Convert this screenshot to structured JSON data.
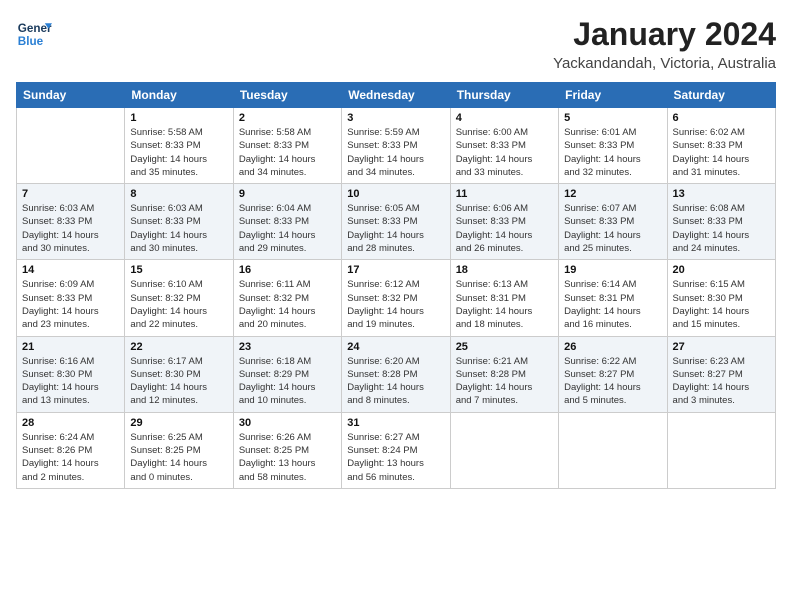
{
  "header": {
    "logo_line1": "General",
    "logo_line2": "Blue",
    "month": "January 2024",
    "location": "Yackandandah, Victoria, Australia"
  },
  "weekdays": [
    "Sunday",
    "Monday",
    "Tuesday",
    "Wednesday",
    "Thursday",
    "Friday",
    "Saturday"
  ],
  "weeks": [
    [
      {
        "day": "",
        "info": ""
      },
      {
        "day": "1",
        "info": "Sunrise: 5:58 AM\nSunset: 8:33 PM\nDaylight: 14 hours\nand 35 minutes."
      },
      {
        "day": "2",
        "info": "Sunrise: 5:58 AM\nSunset: 8:33 PM\nDaylight: 14 hours\nand 34 minutes."
      },
      {
        "day": "3",
        "info": "Sunrise: 5:59 AM\nSunset: 8:33 PM\nDaylight: 14 hours\nand 34 minutes."
      },
      {
        "day": "4",
        "info": "Sunrise: 6:00 AM\nSunset: 8:33 PM\nDaylight: 14 hours\nand 33 minutes."
      },
      {
        "day": "5",
        "info": "Sunrise: 6:01 AM\nSunset: 8:33 PM\nDaylight: 14 hours\nand 32 minutes."
      },
      {
        "day": "6",
        "info": "Sunrise: 6:02 AM\nSunset: 8:33 PM\nDaylight: 14 hours\nand 31 minutes."
      }
    ],
    [
      {
        "day": "7",
        "info": "Sunrise: 6:03 AM\nSunset: 8:33 PM\nDaylight: 14 hours\nand 30 minutes."
      },
      {
        "day": "8",
        "info": "Sunrise: 6:03 AM\nSunset: 8:33 PM\nDaylight: 14 hours\nand 30 minutes."
      },
      {
        "day": "9",
        "info": "Sunrise: 6:04 AM\nSunset: 8:33 PM\nDaylight: 14 hours\nand 29 minutes."
      },
      {
        "day": "10",
        "info": "Sunrise: 6:05 AM\nSunset: 8:33 PM\nDaylight: 14 hours\nand 28 minutes."
      },
      {
        "day": "11",
        "info": "Sunrise: 6:06 AM\nSunset: 8:33 PM\nDaylight: 14 hours\nand 26 minutes."
      },
      {
        "day": "12",
        "info": "Sunrise: 6:07 AM\nSunset: 8:33 PM\nDaylight: 14 hours\nand 25 minutes."
      },
      {
        "day": "13",
        "info": "Sunrise: 6:08 AM\nSunset: 8:33 PM\nDaylight: 14 hours\nand 24 minutes."
      }
    ],
    [
      {
        "day": "14",
        "info": "Sunrise: 6:09 AM\nSunset: 8:33 PM\nDaylight: 14 hours\nand 23 minutes."
      },
      {
        "day": "15",
        "info": "Sunrise: 6:10 AM\nSunset: 8:32 PM\nDaylight: 14 hours\nand 22 minutes."
      },
      {
        "day": "16",
        "info": "Sunrise: 6:11 AM\nSunset: 8:32 PM\nDaylight: 14 hours\nand 20 minutes."
      },
      {
        "day": "17",
        "info": "Sunrise: 6:12 AM\nSunset: 8:32 PM\nDaylight: 14 hours\nand 19 minutes."
      },
      {
        "day": "18",
        "info": "Sunrise: 6:13 AM\nSunset: 8:31 PM\nDaylight: 14 hours\nand 18 minutes."
      },
      {
        "day": "19",
        "info": "Sunrise: 6:14 AM\nSunset: 8:31 PM\nDaylight: 14 hours\nand 16 minutes."
      },
      {
        "day": "20",
        "info": "Sunrise: 6:15 AM\nSunset: 8:30 PM\nDaylight: 14 hours\nand 15 minutes."
      }
    ],
    [
      {
        "day": "21",
        "info": "Sunrise: 6:16 AM\nSunset: 8:30 PM\nDaylight: 14 hours\nand 13 minutes."
      },
      {
        "day": "22",
        "info": "Sunrise: 6:17 AM\nSunset: 8:30 PM\nDaylight: 14 hours\nand 12 minutes."
      },
      {
        "day": "23",
        "info": "Sunrise: 6:18 AM\nSunset: 8:29 PM\nDaylight: 14 hours\nand 10 minutes."
      },
      {
        "day": "24",
        "info": "Sunrise: 6:20 AM\nSunset: 8:28 PM\nDaylight: 14 hours\nand 8 minutes."
      },
      {
        "day": "25",
        "info": "Sunrise: 6:21 AM\nSunset: 8:28 PM\nDaylight: 14 hours\nand 7 minutes."
      },
      {
        "day": "26",
        "info": "Sunrise: 6:22 AM\nSunset: 8:27 PM\nDaylight: 14 hours\nand 5 minutes."
      },
      {
        "day": "27",
        "info": "Sunrise: 6:23 AM\nSunset: 8:27 PM\nDaylight: 14 hours\nand 3 minutes."
      }
    ],
    [
      {
        "day": "28",
        "info": "Sunrise: 6:24 AM\nSunset: 8:26 PM\nDaylight: 14 hours\nand 2 minutes."
      },
      {
        "day": "29",
        "info": "Sunrise: 6:25 AM\nSunset: 8:25 PM\nDaylight: 14 hours\nand 0 minutes."
      },
      {
        "day": "30",
        "info": "Sunrise: 6:26 AM\nSunset: 8:25 PM\nDaylight: 13 hours\nand 58 minutes."
      },
      {
        "day": "31",
        "info": "Sunrise: 6:27 AM\nSunset: 8:24 PM\nDaylight: 13 hours\nand 56 minutes."
      },
      {
        "day": "",
        "info": ""
      },
      {
        "day": "",
        "info": ""
      },
      {
        "day": "",
        "info": ""
      }
    ]
  ]
}
